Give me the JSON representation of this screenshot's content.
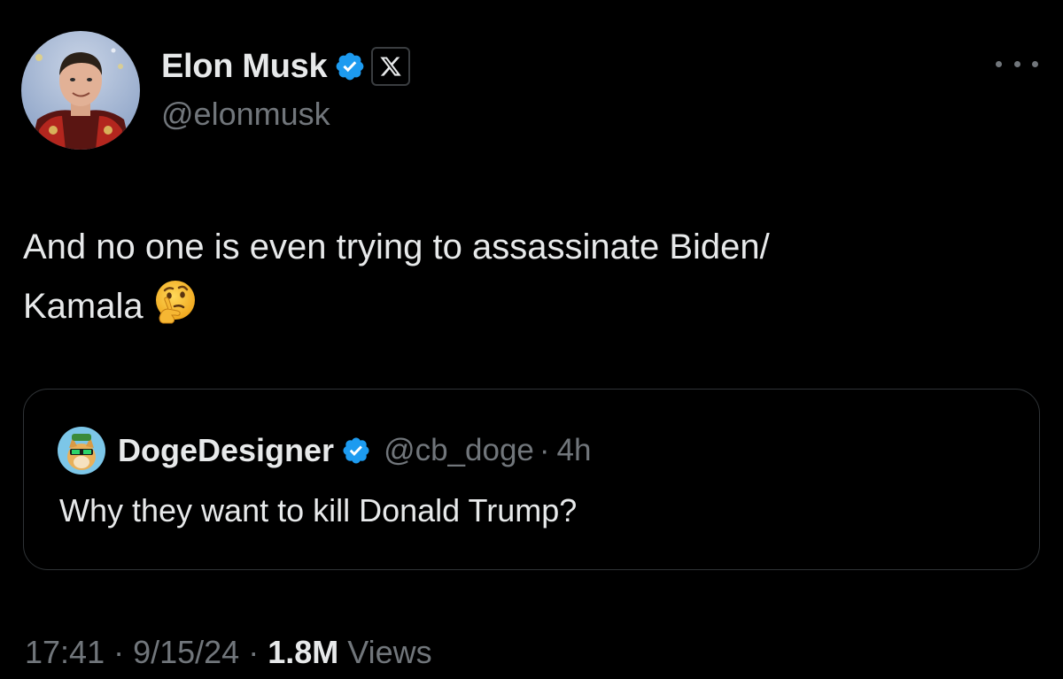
{
  "author": {
    "display_name": "Elon Musk",
    "handle": "@elonmusk",
    "verified_icon": "verified-badge-icon",
    "affiliation_icon": "x-logo-icon",
    "badge_color": "#1d9bf0"
  },
  "more_icon": "more-options-icon",
  "tweet": {
    "text_line1": "And no one is even trying to assassinate Biden/",
    "text_line2": "Kamala",
    "emoji": "thinking-face-emoji"
  },
  "quoted": {
    "display_name": "DogeDesigner",
    "handle": "@cb_doge",
    "separator": "·",
    "time": "4h",
    "text": "Why they want to kill Donald Trump?"
  },
  "meta": {
    "time": "17:41",
    "date": "9/15/24",
    "separator": "·",
    "views_count": "1.8M",
    "views_label": "Views"
  },
  "colors": {
    "background": "#000000",
    "primary_text": "#e7e9ea",
    "secondary_text": "#71767b",
    "border": "#2f3336",
    "verified_blue": "#1d9bf0"
  }
}
